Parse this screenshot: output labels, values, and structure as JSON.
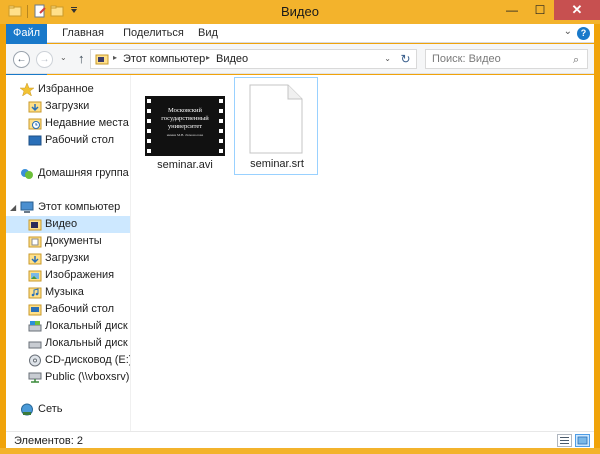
{
  "window": {
    "title": "Видео",
    "minimize": "—",
    "maximize": "☐",
    "close": "✕"
  },
  "ribbon": {
    "tabs": [
      "Файл",
      "Главная",
      "Поделиться",
      "Вид"
    ],
    "collapse": "⌄",
    "help": "?"
  },
  "navigation": {
    "back": "←",
    "forward": "→",
    "recent": "⌄",
    "up": "↑",
    "breadcrumb": [
      "Этот компьютер",
      "Видео"
    ],
    "separator": "▸",
    "refresh": "↻",
    "search_placeholder": "Поиск: Видео",
    "search_icon": "⌕"
  },
  "sidebar": {
    "favorites": {
      "label": "Избранное",
      "items": [
        "Загрузки",
        "Недавние места",
        "Рабочий стол"
      ]
    },
    "homegroup": "Домашняя группа",
    "computer": {
      "label": "Этот компьютер",
      "items": [
        {
          "label": "Видео",
          "icon": "video-folder-icon",
          "selected": true
        },
        {
          "label": "Документы",
          "icon": "documents-folder-icon",
          "selected": false
        },
        {
          "label": "Загрузки",
          "icon": "downloads-folder-icon",
          "selected": false
        },
        {
          "label": "Изображения",
          "icon": "pictures-folder-icon",
          "selected": false
        },
        {
          "label": "Музыка",
          "icon": "music-folder-icon",
          "selected": false
        },
        {
          "label": "Рабочий стол",
          "icon": "desktop-folder-icon",
          "selected": false
        },
        {
          "label": "Локальный диск (C",
          "icon": "local-disk-icon",
          "selected": false
        },
        {
          "label": "Локальный диск (D",
          "icon": "local-disk-icon",
          "selected": false
        },
        {
          "label": "CD-дисковод (E:) Vi",
          "icon": "cd-drive-icon",
          "selected": false
        },
        {
          "label": "Public (\\\\vboxsrv) (F",
          "icon": "network-drive-icon",
          "selected": false
        }
      ]
    },
    "network": "Сеть"
  },
  "files": [
    {
      "name": "seminar.avi",
      "icon": "video-file-icon",
      "thumbnail_lines": [
        "Московский",
        "государственный",
        "университет",
        "имени М.В. Ломоносова"
      ]
    },
    {
      "name": "seminar.srt",
      "icon": "text-file-icon"
    }
  ],
  "status": {
    "items_count": "Элементов: 2"
  },
  "colors": {
    "frame": "#f3b32c",
    "accent": "#1979ca",
    "selection": "#cde8ff",
    "selection_border": "#99d1ff"
  }
}
